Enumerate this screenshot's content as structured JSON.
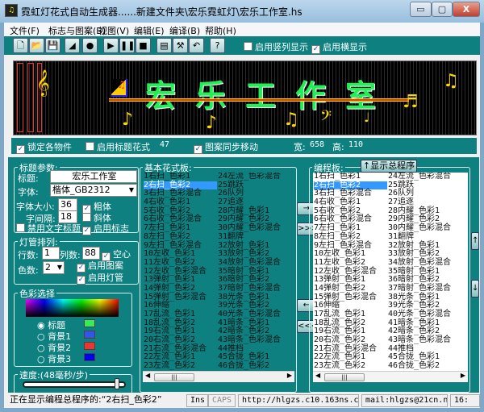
{
  "window": {
    "title": "霓虹灯花式自动生成器......新建文件夹\\宏乐霓虹灯\\宏乐工作室.hs",
    "minimize": "▭",
    "maximize": "▢",
    "close": "X"
  },
  "menu": [
    "文件(F)",
    "标志与图案(B)",
    "视图(V)",
    "编辑(E)",
    "编译(B)",
    "帮助(H)"
  ],
  "toolbar": {
    "icons": [
      "new-file-icon",
      "open-folder-icon",
      "save-icon",
      "chart-icon",
      "record-icon",
      "play-icon",
      "pause-icon",
      "stop-icon",
      "properties-icon",
      "tools-icon",
      "undo-icon",
      "help-icon"
    ],
    "glyphs": [
      "🗋",
      "📂",
      "💾",
      "◢",
      "●",
      "▶",
      "❚❚",
      "■",
      "▤",
      "⚒",
      "↶",
      "?"
    ],
    "vertical_display": {
      "label": "启用竖列显示",
      "checked": false
    },
    "horizontal_display": {
      "label": "启用横显示",
      "checked": true
    }
  },
  "led": {
    "text": "宏乐工作室",
    "colors": {
      "text": "#22ee55",
      "underline": "#ff2200",
      "notes": "#ffd800"
    }
  },
  "options": {
    "lock": {
      "label": "锁定各物件",
      "checked": true
    },
    "title_pattern": {
      "label": "启用标题花式",
      "checked": false
    },
    "count": "47",
    "sync": {
      "label": "图案同步移动",
      "checked": true
    },
    "width_label": "宽:",
    "width": "658",
    "height_label": "高:",
    "height": "110"
  },
  "title_params": {
    "legend": "标题参数:",
    "title_label": "标题:",
    "title_value": "宏乐工作室",
    "font_label": "字体:",
    "font_value": "楷体_GB2312",
    "size_label": "字体大小:",
    "size_value": "36",
    "spacing_label": "字间隔:",
    "spacing_value": "18",
    "bold": {
      "label": "粗体",
      "checked": true
    },
    "italic": {
      "label": "斜体",
      "checked": false
    },
    "disable_text": {
      "label": "禁用文字标题",
      "checked": false
    },
    "enable_logo": {
      "label": "启用标志",
      "checked": true
    }
  },
  "tubes": {
    "legend": "灯管排列:",
    "rows_label": "行数:",
    "rows": "1",
    "cols_label": "列数:",
    "cols": "88",
    "hollow": {
      "label": "空心",
      "checked": true
    },
    "colors_label": "色数:",
    "colors_value": "2",
    "enable_pattern": {
      "label": "启用图案",
      "checked": true
    },
    "enable_tube": {
      "label": "启用灯管",
      "checked": true
    }
  },
  "color_select": {
    "legend": "色彩选择",
    "options": [
      {
        "label": "标题",
        "color": "#33ee55",
        "selected": true
      },
      {
        "label": "背景1",
        "color": "#3355ee",
        "selected": false
      },
      {
        "label": "背景2",
        "color": "#ee3333",
        "selected": false
      },
      {
        "label": "背景3",
        "color": "#0000ee",
        "selected": false
      }
    ]
  },
  "speed": {
    "legend": "速度:(48毫秒/步)",
    "value_fraction": 0.95
  },
  "basic_panel": {
    "legend": "基本花式板:",
    "selected": 1
  },
  "program_panel": {
    "legend": "编程板:",
    "show_button": "↑显示总程序",
    "selected": 1
  },
  "move_buttons": {
    "add": "→",
    "add_all": ">>>",
    "remove": "←",
    "remove_all": "<<<",
    "up": "↑",
    "down": "↓"
  },
  "items": [
    "1右扫_色彩1",
    "2右扫_色彩2",
    "3右扫_色彩混合",
    "4右收_色彩1",
    "5右收_色彩2",
    "6右收_色彩混合",
    "7左扫_色彩1",
    "8左扫_色彩2",
    "9左扫_色彩混合",
    "10左收_色彩1",
    "11左收_色彩2",
    "12左收_色彩混合",
    "13弹射_色彩1",
    "14弹射_色彩2",
    "15弹射_色彩混合",
    "16伸缩",
    "17乱流_色彩1",
    "18乱流_色彩2",
    "19右流_色彩1",
    "20右流_色彩2",
    "21右流_色彩混合",
    "22左流_色彩1",
    "23左流_色彩2",
    "24左流_色彩混合",
    "25跳跃",
    "26队列",
    "27追逐",
    "28内耀_色彩1",
    "29内耀_色彩2",
    "30内耀_色彩混合",
    "31翻牌",
    "32放射_色彩1",
    "33放射_色彩2",
    "34放射_色彩混合",
    "35暗射_色彩1",
    "36暗射_色彩2",
    "37暗射_色彩混合",
    "38光条_色彩1",
    "39光条_色彩2",
    "40光条_色彩混合",
    "41暗条_色彩1",
    "42暗条_色彩2",
    "43暗条_色彩混合",
    "44推档",
    "45合拢_色彩1",
    "46合拢_色彩2"
  ],
  "status": {
    "message": "正在显示编程总程序的:“2右扫_色彩2”",
    "ins": "Ins",
    "caps": "CAPS",
    "url": "http://hlgzs.c10.163ns.com",
    "mail": "mail:hlgzs@21cn.net",
    "pos": "16:"
  }
}
